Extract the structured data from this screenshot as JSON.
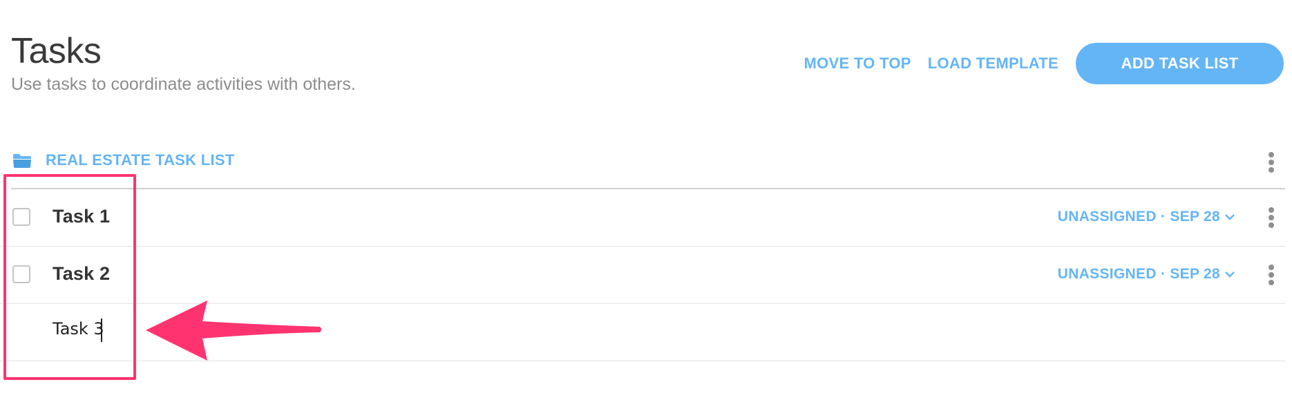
{
  "header": {
    "title": "Tasks",
    "subtitle": "Use tasks to coordinate activities with others."
  },
  "actions": {
    "move_to_top": "MOVE TO TOP",
    "load_template": "LOAD TEMPLATE",
    "add_task_list": "ADD TASK LIST"
  },
  "task_list": {
    "title": "REAL ESTATE TASK LIST",
    "icon": "folder-icon",
    "tasks": [
      {
        "name": "Task 1",
        "meta": "UNASSIGNED · SEP 28",
        "checked": false
      },
      {
        "name": "Task 2",
        "meta": "UNASSIGNED · SEP 28",
        "checked": false
      }
    ],
    "new_task": {
      "value": "Task 3"
    }
  },
  "colors": {
    "accent": "#64b5f6",
    "annotation": "#ff3370"
  }
}
